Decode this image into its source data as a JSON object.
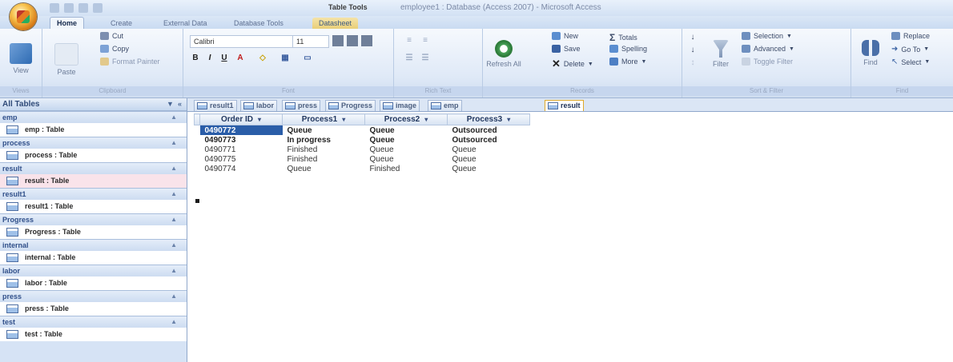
{
  "titlebar": {
    "context_tab": "Table Tools",
    "window_title": "employee1 : Database (Access 2007) - Microsoft Access"
  },
  "ribbon_tabs": [
    {
      "label": "Home",
      "active": true
    },
    {
      "label": "Create"
    },
    {
      "label": "External Data"
    },
    {
      "label": "Database Tools"
    },
    {
      "label": "Datasheet",
      "contextual": true
    }
  ],
  "ribbon": {
    "views": {
      "view_label": "View",
      "group": "Views"
    },
    "clipboard": {
      "paste_label": "Paste",
      "cut": "Cut",
      "copy": "Copy",
      "format_painter": "Format Painter",
      "group": "Clipboard"
    },
    "font": {
      "name": "Calibri",
      "size": "11",
      "group": "Font"
    },
    "rich_text": {
      "group": "Rich Text"
    },
    "records": {
      "refresh": "Refresh All",
      "new": "New",
      "save": "Save",
      "delete": "Delete",
      "totals": "Totals",
      "spelling": "Spelling",
      "more": "More",
      "group": "Records"
    },
    "sort_filter": {
      "filter": "Filter",
      "selection": "Selection",
      "advanced": "Advanced",
      "toggle_filter": "Toggle Filter",
      "group": "Sort & Filter"
    },
    "find": {
      "find": "Find",
      "replace": "Replace",
      "goto": "Go To",
      "select": "Select",
      "group": "Find"
    }
  },
  "nav": {
    "header": "All Tables",
    "groups": [
      {
        "name": "emp",
        "item": "emp : Table"
      },
      {
        "name": "process",
        "item": "process : Table"
      },
      {
        "name": "result",
        "item": "result : Table",
        "selected": true
      },
      {
        "name": "result1",
        "item": "result1 : Table"
      },
      {
        "name": "Progress",
        "item": "Progress : Table"
      },
      {
        "name": "internal",
        "item": "internal : Table"
      },
      {
        "name": "labor",
        "item": "labor : Table"
      },
      {
        "name": "press",
        "item": "press : Table"
      },
      {
        "name": "test",
        "item": "test : Table"
      }
    ]
  },
  "doc_tabs": [
    "result1",
    "labor",
    "press",
    "Progress",
    "image",
    "emp",
    "result"
  ],
  "datasheet": {
    "columns": [
      "Order ID",
      "Process1",
      "Process2",
      "Process3"
    ],
    "rows": [
      [
        "0490772",
        "Queue",
        "Queue",
        "Outsourced"
      ],
      [
        "0490773",
        "In progress",
        "Queue",
        "Outsourced"
      ],
      [
        "0490771",
        "Finished",
        "Queue",
        "Queue"
      ],
      [
        "0490775",
        "Finished",
        "Queue",
        "Queue"
      ],
      [
        "0490774",
        "Queue",
        "Finished",
        "Queue"
      ]
    ]
  }
}
